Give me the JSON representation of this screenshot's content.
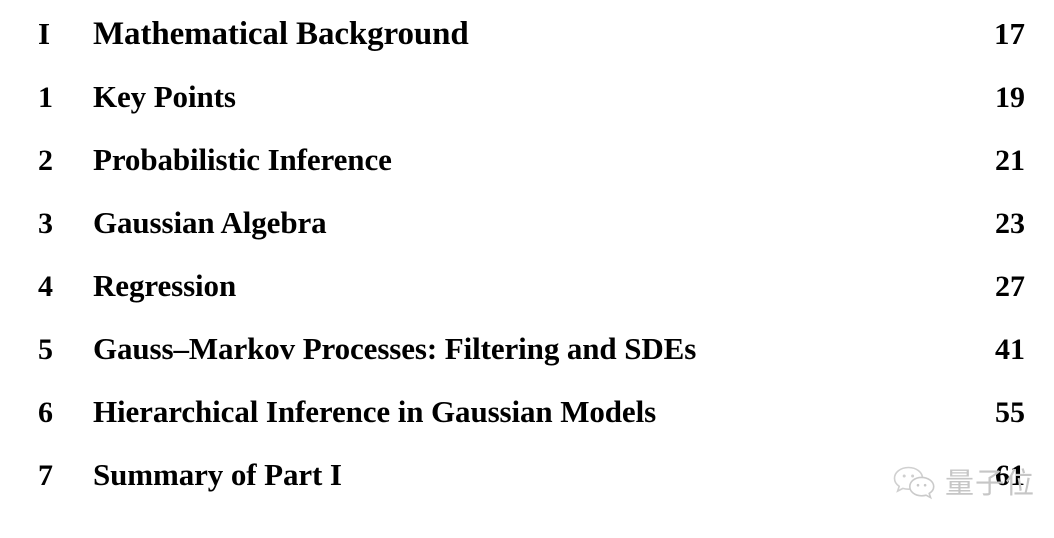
{
  "document": {
    "type": "table-of-contents",
    "background_color": "#ffffff",
    "text_color": "#000000"
  },
  "toc": {
    "entries": [
      {
        "number": "I",
        "title": "Mathematical Background",
        "page": "17",
        "level": "part"
      },
      {
        "number": "1",
        "title": "Key Points",
        "page": "19",
        "level": "chapter"
      },
      {
        "number": "2",
        "title": "Probabilistic Inference",
        "page": "21",
        "level": "chapter"
      },
      {
        "number": "3",
        "title": "Gaussian Algebra",
        "page": "23",
        "level": "chapter"
      },
      {
        "number": "4",
        "title": "Regression",
        "page": "27",
        "level": "chapter"
      },
      {
        "number": "5",
        "title": "Gauss–Markov Processes: Filtering and SDEs",
        "page": "41",
        "level": "chapter"
      },
      {
        "number": "6",
        "title": "Hierarchical Inference in Gaussian Models",
        "page": "55",
        "level": "chapter"
      },
      {
        "number": "7",
        "title": "Summary of Part I",
        "page": "61",
        "level": "chapter"
      }
    ]
  },
  "watermark": {
    "logo_icon": "wechat-icon",
    "text": "量子位",
    "color": "#c6c6c6"
  }
}
